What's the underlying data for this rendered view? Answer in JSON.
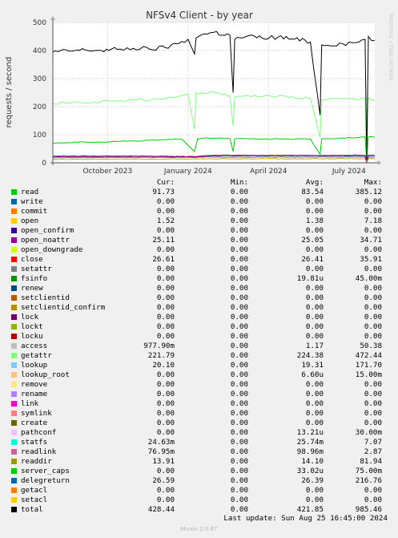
{
  "chart_data": {
    "type": "line",
    "title": "NFSv4 Client - by year",
    "ylabel": "requests / second",
    "watermark": "RRDTOOL / TOBI OETIKER",
    "ylim": [
      0,
      500
    ],
    "yticks": [
      "0",
      "100",
      "200",
      "300",
      "400",
      "500"
    ],
    "xticks": [
      {
        "t": 0.17,
        "label": "October 2023"
      },
      {
        "t": 0.42,
        "label": "January 2024"
      },
      {
        "t": 0.67,
        "label": "April 2024"
      },
      {
        "t": 0.92,
        "label": "July 2024"
      }
    ],
    "series_lines": [
      {
        "name": "total",
        "color": "#000000",
        "width": 1,
        "points": [
          [
            0,
            395
          ],
          [
            0.05,
            398
          ],
          [
            0.1,
            402
          ],
          [
            0.15,
            400
          ],
          [
            0.2,
            404
          ],
          [
            0.25,
            408
          ],
          [
            0.3,
            405
          ],
          [
            0.35,
            410
          ],
          [
            0.4,
            432
          ],
          [
            0.42,
            440
          ],
          [
            0.44,
            388
          ],
          [
            0.445,
            445
          ],
          [
            0.46,
            455
          ],
          [
            0.5,
            465
          ],
          [
            0.55,
            455
          ],
          [
            0.56,
            250
          ],
          [
            0.565,
            440
          ],
          [
            0.6,
            450
          ],
          [
            0.65,
            445
          ],
          [
            0.7,
            448
          ],
          [
            0.75,
            440
          ],
          [
            0.8,
            430
          ],
          [
            0.83,
            170
          ],
          [
            0.835,
            420
          ],
          [
            0.9,
            425
          ],
          [
            0.95,
            430
          ],
          [
            0.97,
            440
          ],
          [
            0.975,
            10
          ],
          [
            0.98,
            450
          ],
          [
            1.0,
            435
          ]
        ]
      },
      {
        "name": "getattr",
        "color": "#80ff80",
        "width": 1,
        "points": [
          [
            0,
            210
          ],
          [
            0.05,
            215
          ],
          [
            0.1,
            212
          ],
          [
            0.15,
            218
          ],
          [
            0.2,
            220
          ],
          [
            0.25,
            225
          ],
          [
            0.3,
            222
          ],
          [
            0.35,
            228
          ],
          [
            0.4,
            240
          ],
          [
            0.42,
            245
          ],
          [
            0.44,
            120
          ],
          [
            0.445,
            250
          ],
          [
            0.5,
            250
          ],
          [
            0.55,
            240
          ],
          [
            0.56,
            130
          ],
          [
            0.565,
            235
          ],
          [
            0.6,
            240
          ],
          [
            0.65,
            236
          ],
          [
            0.7,
            238
          ],
          [
            0.75,
            232
          ],
          [
            0.8,
            230
          ],
          [
            0.83,
            90
          ],
          [
            0.835,
            225
          ],
          [
            0.9,
            228
          ],
          [
            0.95,
            225
          ],
          [
            0.97,
            230
          ],
          [
            0.975,
            5
          ],
          [
            0.98,
            232
          ],
          [
            1.0,
            222
          ]
        ]
      },
      {
        "name": "read",
        "color": "#00cc00",
        "width": 1,
        "points": [
          [
            0,
            70
          ],
          [
            0.05,
            72
          ],
          [
            0.1,
            74
          ],
          [
            0.15,
            73
          ],
          [
            0.2,
            76
          ],
          [
            0.25,
            78
          ],
          [
            0.3,
            80
          ],
          [
            0.35,
            82
          ],
          [
            0.4,
            84
          ],
          [
            0.44,
            40
          ],
          [
            0.45,
            86
          ],
          [
            0.5,
            88
          ],
          [
            0.55,
            86
          ],
          [
            0.56,
            40
          ],
          [
            0.565,
            85
          ],
          [
            0.6,
            86
          ],
          [
            0.65,
            84
          ],
          [
            0.7,
            85
          ],
          [
            0.75,
            84
          ],
          [
            0.8,
            85
          ],
          [
            0.83,
            30
          ],
          [
            0.835,
            86
          ],
          [
            0.9,
            88
          ],
          [
            0.95,
            90
          ],
          [
            0.97,
            92
          ],
          [
            0.975,
            5
          ],
          [
            0.98,
            92
          ],
          [
            1.0,
            91
          ]
        ]
      },
      {
        "name": "open_noattr",
        "color": "#990099",
        "width": 1,
        "points": [
          [
            0,
            22
          ],
          [
            0.3,
            23
          ],
          [
            0.44,
            20
          ],
          [
            0.5,
            25
          ],
          [
            0.8,
            25
          ],
          [
            0.97,
            25
          ],
          [
            0.975,
            2
          ],
          [
            0.98,
            25
          ],
          [
            1.0,
            25
          ]
        ]
      },
      {
        "name": "close",
        "color": "#ff0000",
        "width": 1,
        "points": [
          [
            0,
            22
          ],
          [
            0.3,
            23
          ],
          [
            0.44,
            21
          ],
          [
            0.5,
            26
          ],
          [
            0.8,
            26
          ],
          [
            0.97,
            26
          ],
          [
            0.975,
            2
          ],
          [
            0.98,
            26
          ],
          [
            1.0,
            26
          ]
        ]
      },
      {
        "name": "delegreturn",
        "color": "#0066b3",
        "width": 1,
        "points": [
          [
            0,
            24
          ],
          [
            0.3,
            24
          ],
          [
            0.44,
            22
          ],
          [
            0.5,
            27
          ],
          [
            0.8,
            26
          ],
          [
            0.97,
            27
          ],
          [
            0.975,
            2
          ],
          [
            0.98,
            27
          ],
          [
            1.0,
            27
          ]
        ]
      },
      {
        "name": "lookup",
        "color": "#00aa88",
        "width": 1,
        "points": [
          [
            0,
            18
          ],
          [
            0.3,
            19
          ],
          [
            0.5,
            20
          ],
          [
            0.8,
            20
          ],
          [
            0.97,
            20
          ],
          [
            0.975,
            2
          ],
          [
            0.98,
            20
          ],
          [
            1.0,
            20
          ]
        ]
      },
      {
        "name": "readdir",
        "color": "#ccaa00",
        "width": 1,
        "points": [
          [
            0,
            12
          ],
          [
            0.3,
            13
          ],
          [
            0.5,
            14
          ],
          [
            0.8,
            14
          ],
          [
            0.97,
            14
          ],
          [
            0.975,
            1
          ],
          [
            0.98,
            14
          ],
          [
            1.0,
            14
          ]
        ]
      }
    ],
    "columns": [
      "Cur:",
      "Min:",
      "Avg:",
      "Max:"
    ],
    "legend": [
      {
        "name": "read",
        "color": "#00cc00",
        "cur": "91.73",
        "min": "0.00",
        "avg": "83.54",
        "max": "385.12"
      },
      {
        "name": "write",
        "color": "#0066b3",
        "cur": "0.00",
        "min": "0.00",
        "avg": "0.00",
        "max": "0.00"
      },
      {
        "name": "commit",
        "color": "#ff8000",
        "cur": "0.00",
        "min": "0.00",
        "avg": "0.00",
        "max": "0.00"
      },
      {
        "name": "open",
        "color": "#ffcc00",
        "cur": "1.52",
        "min": "0.00",
        "avg": "1.38",
        "max": "7.18"
      },
      {
        "name": "open_confirm",
        "color": "#330099",
        "cur": "0.00",
        "min": "0.00",
        "avg": "0.00",
        "max": "0.00"
      },
      {
        "name": "open_noattr",
        "color": "#990099",
        "cur": "25.11",
        "min": "0.00",
        "avg": "25.05",
        "max": "34.71"
      },
      {
        "name": "open_downgrade",
        "color": "#ccff00",
        "cur": "0.00",
        "min": "0.00",
        "avg": "0.00",
        "max": "0.00"
      },
      {
        "name": "close",
        "color": "#ff0000",
        "cur": "26.61",
        "min": "0.00",
        "avg": "26.41",
        "max": "35.91"
      },
      {
        "name": "setattr",
        "color": "#808080",
        "cur": "0.00",
        "min": "0.00",
        "avg": "0.00",
        "max": "0.00"
      },
      {
        "name": "fsinfo",
        "color": "#008f00",
        "cur": "0.00",
        "min": "0.00",
        "avg": "19.81u",
        "max": "45.00m"
      },
      {
        "name": "renew",
        "color": "#00487d",
        "cur": "0.00",
        "min": "0.00",
        "avg": "0.00",
        "max": "0.00"
      },
      {
        "name": "setclientid",
        "color": "#b35a00",
        "cur": "0.00",
        "min": "0.00",
        "avg": "0.00",
        "max": "0.00"
      },
      {
        "name": "setclientid_confirm",
        "color": "#b38f00",
        "cur": "0.00",
        "min": "0.00",
        "avg": "0.00",
        "max": "0.00"
      },
      {
        "name": "lock",
        "color": "#6b006b",
        "cur": "0.00",
        "min": "0.00",
        "avg": "0.00",
        "max": "0.00"
      },
      {
        "name": "lockt",
        "color": "#8fb300",
        "cur": "0.00",
        "min": "0.00",
        "avg": "0.00",
        "max": "0.00"
      },
      {
        "name": "locku",
        "color": "#b30000",
        "cur": "0.00",
        "min": "0.00",
        "avg": "0.00",
        "max": "0.00"
      },
      {
        "name": "access",
        "color": "#bebebe",
        "cur": "977.90m",
        "min": "0.00",
        "avg": "1.17",
        "max": "50.38"
      },
      {
        "name": "getattr",
        "color": "#80ff80",
        "cur": "221.79",
        "min": "0.00",
        "avg": "224.38",
        "max": "472.44"
      },
      {
        "name": "lookup",
        "color": "#80c9ff",
        "cur": "20.10",
        "min": "0.00",
        "avg": "19.31",
        "max": "171.70"
      },
      {
        "name": "lookup_root",
        "color": "#ffc080",
        "cur": "0.00",
        "min": "0.00",
        "avg": "6.60u",
        "max": "15.00m"
      },
      {
        "name": "remove",
        "color": "#ffe680",
        "cur": "0.00",
        "min": "0.00",
        "avg": "0.00",
        "max": "0.00"
      },
      {
        "name": "rename",
        "color": "#aa80ff",
        "cur": "0.00",
        "min": "0.00",
        "avg": "0.00",
        "max": "0.00"
      },
      {
        "name": "link",
        "color": "#ee00cc",
        "cur": "0.00",
        "min": "0.00",
        "avg": "0.00",
        "max": "0.00"
      },
      {
        "name": "symlink",
        "color": "#ff8080",
        "cur": "0.00",
        "min": "0.00",
        "avg": "0.00",
        "max": "0.00"
      },
      {
        "name": "create",
        "color": "#666600",
        "cur": "0.00",
        "min": "0.00",
        "avg": "0.00",
        "max": "0.00"
      },
      {
        "name": "pathconf",
        "color": "#ffbfff",
        "cur": "0.00",
        "min": "0.00",
        "avg": "13.21u",
        "max": "30.00m"
      },
      {
        "name": "statfs",
        "color": "#00ffcc",
        "cur": "24.63m",
        "min": "0.00",
        "avg": "25.74m",
        "max": "7.07"
      },
      {
        "name": "readlink",
        "color": "#cc6699",
        "cur": "76.95m",
        "min": "0.00",
        "avg": "98.96m",
        "max": "2.87"
      },
      {
        "name": "readdir",
        "color": "#999900",
        "cur": "13.91",
        "min": "0.00",
        "avg": "14.10",
        "max": "81.94"
      },
      {
        "name": "server_caps",
        "color": "#00cc00",
        "cur": "0.00",
        "min": "0.00",
        "avg": "33.02u",
        "max": "75.00m"
      },
      {
        "name": "delegreturn",
        "color": "#0066b3",
        "cur": "26.59",
        "min": "0.00",
        "avg": "26.39",
        "max": "216.76"
      },
      {
        "name": "getacl",
        "color": "#ff8000",
        "cur": "0.00",
        "min": "0.00",
        "avg": "0.00",
        "max": "0.00"
      },
      {
        "name": "setacl",
        "color": "#ffcc00",
        "cur": "0.00",
        "min": "0.00",
        "avg": "0.00",
        "max": "0.00"
      },
      {
        "name": "total",
        "color": "#000000",
        "cur": "428.44",
        "min": "0.00",
        "avg": "421.85",
        "max": "985.46"
      }
    ]
  },
  "footer": {
    "last_update": "Last update: Sun Aug 25 16:45:00 2024",
    "version": "Munin 2.0.67"
  }
}
